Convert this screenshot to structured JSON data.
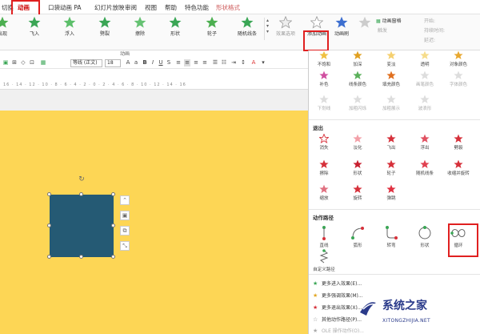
{
  "tabs": [
    {
      "label": "切换",
      "state": "normal"
    },
    {
      "label": "动画",
      "state": "active"
    },
    {
      "label": "口袋动画 PA",
      "state": "normal"
    },
    {
      "label": "幻灯片放映",
      "state": "normal"
    },
    {
      "label": "审阅",
      "state": "normal"
    },
    {
      "label": "视图",
      "state": "normal"
    },
    {
      "label": "帮助",
      "state": "normal"
    },
    {
      "label": "特色功能",
      "state": "normal"
    },
    {
      "label": "形状格式",
      "state": "contextual"
    }
  ],
  "ribbon": {
    "effects": [
      "出现",
      "飞入",
      "浮入",
      "劈裂",
      "擦除",
      "形状",
      "轮子",
      "随机线条"
    ],
    "effect_options": "效果选项",
    "group_caption": "动画",
    "add_animation": "添加动画",
    "animation_painter": "动画刷",
    "animation_pane": "动画窗格",
    "trigger": "触发",
    "start_label": "开始:",
    "duration_label": "持续时间:",
    "delay_label": "延迟:"
  },
  "format_bar": {
    "font": "等线 (正文)",
    "size": "18"
  },
  "ruler_text": "16 · 14 · 12 · 10 · 8 · 6 · 4 · 2 · 0 · 2 · 4 · 6 · 8 · 10 · 12 · 14 · 16",
  "panel": {
    "emphasis_row1": [
      "不饱和",
      "加深",
      "变淡",
      "透明",
      "对象颜色"
    ],
    "emphasis_row2": [
      "补色",
      "线条颜色",
      "填充颜色",
      "画笔颜色",
      "字体颜色"
    ],
    "emphasis_row3": [
      "下划线",
      "加粗闪烁",
      "加粗展示",
      "波浪形"
    ],
    "exit_title": "退出",
    "exit_row1": [
      "消失",
      "淡化",
      "飞出",
      "浮出",
      "劈裂"
    ],
    "exit_row2": [
      "擦除",
      "形状",
      "轮子",
      "随机线条",
      "收缩并旋转"
    ],
    "exit_row3": [
      "缩放",
      "旋转",
      "弹跳"
    ],
    "path_title": "动作路径",
    "path_items": [
      "直线",
      "弧形",
      "转弯",
      "形状",
      "循环"
    ],
    "custom_path": "自定义路径",
    "menu": [
      {
        "label": "更多进入效果(E)...",
        "icon": "star-green-icon",
        "color": "#3aa655"
      },
      {
        "label": "更多强调效果(M)...",
        "icon": "star-yellow-icon",
        "color": "#e2a622"
      },
      {
        "label": "更多退出效果(X)...",
        "icon": "star-red-icon",
        "color": "#d6303a"
      },
      {
        "label": "其他动作路径(P)...",
        "icon": "star-outline-icon",
        "color": "#888888"
      },
      {
        "label": "OLE 操作动作(O)...",
        "icon": "star-gray-icon",
        "color": "#aaaaaa"
      }
    ]
  },
  "watermark": {
    "title": "系统之家",
    "subtitle": "XITONGZHIJIA.NET"
  },
  "colors": {
    "slide": "#fdd655",
    "shape": "#255a74",
    "accent_red": "#e02020",
    "entrance": "#3aa655",
    "emphasis": "#e2a622",
    "exit": "#d6303a"
  }
}
